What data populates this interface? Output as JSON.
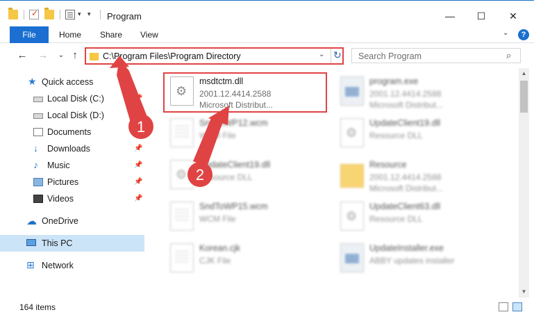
{
  "window": {
    "title": "Program",
    "minimize": "—",
    "maximize": "☐",
    "close": "✕"
  },
  "ribbon": {
    "tabs": [
      "File",
      "Home",
      "Share",
      "View"
    ],
    "collapse": "⌄",
    "help": "?"
  },
  "address": {
    "path": "C:\\Program Files\\Program Directory",
    "dropdown": "⌄",
    "refresh": "↻"
  },
  "search": {
    "placeholder": "Search Program",
    "icon": "⌕"
  },
  "nav": {
    "back": "←",
    "forward": "→",
    "recent": "⌄",
    "up": "↑"
  },
  "sidebar": {
    "items": [
      {
        "label": "Quick access",
        "icon": "star-icon"
      },
      {
        "label": "Local Disk (C:)",
        "icon": "drive-icon",
        "pinned": true
      },
      {
        "label": "Local Disk (D:)",
        "icon": "drive-icon"
      },
      {
        "label": "Documents",
        "icon": "documents-icon",
        "pinned": true
      },
      {
        "label": "Downloads",
        "icon": "download-icon",
        "pinned": true
      },
      {
        "label": "Music",
        "icon": "music-icon",
        "pinned": true
      },
      {
        "label": "Pictures",
        "icon": "pictures-icon",
        "pinned": true
      },
      {
        "label": "Videos",
        "icon": "videos-icon",
        "pinned": true
      },
      {
        "label": "OneDrive",
        "icon": "cloud-icon"
      },
      {
        "label": "This PC",
        "icon": "computer-icon",
        "selected": true
      },
      {
        "label": "Network",
        "icon": "network-icon"
      }
    ],
    "pin_glyph": "📌"
  },
  "files": [
    {
      "name": "msdtctm.dll",
      "line2": "2001.12.4414.2588",
      "line3": "Microsoft Distribut...",
      "icon": "dll-gear-icon",
      "highlighted": true
    },
    {
      "name": "program.exe",
      "line2": "2001.12.4414.2588",
      "line3": "Microsoft Distribut...",
      "icon": "exe-icon"
    },
    {
      "name": "SndToWP12.wcm",
      "line2": "WCM File",
      "line3": "",
      "icon": "document-icon"
    },
    {
      "name": "UpdateClient19.dll",
      "line2": "Resource DLL",
      "line3": "",
      "icon": "dll-gear-icon"
    },
    {
      "name": "UpdateClient19.dll",
      "line2": "Resource DLL",
      "line3": "",
      "icon": "dll-gear-icon"
    },
    {
      "name": "Resource",
      "line2": "2001.12.4414.2588",
      "line3": "Microsoft Distribut...",
      "icon": "folder-icon"
    },
    {
      "name": "SndToWP15.wcm",
      "line2": "WCM File",
      "line3": "",
      "icon": "document-icon"
    },
    {
      "name": "UpdateClient63.dll",
      "line2": "Resource DLL",
      "line3": "",
      "icon": "dll-gear-icon"
    },
    {
      "name": "Korean.cjk",
      "line2": "CJK File",
      "line3": "",
      "icon": "document-icon"
    },
    {
      "name": "UpdateInstaller.exe",
      "line2": "ABBY updates installer",
      "line3": "",
      "icon": "exe-icon"
    }
  ],
  "annotations": {
    "step1": "1",
    "step2": "2",
    "color": "#e04343"
  },
  "status": {
    "count": "164 items"
  },
  "colors": {
    "accent": "#1a6fd0",
    "selection": "#cce4f7",
    "highlight": "#e04343"
  }
}
